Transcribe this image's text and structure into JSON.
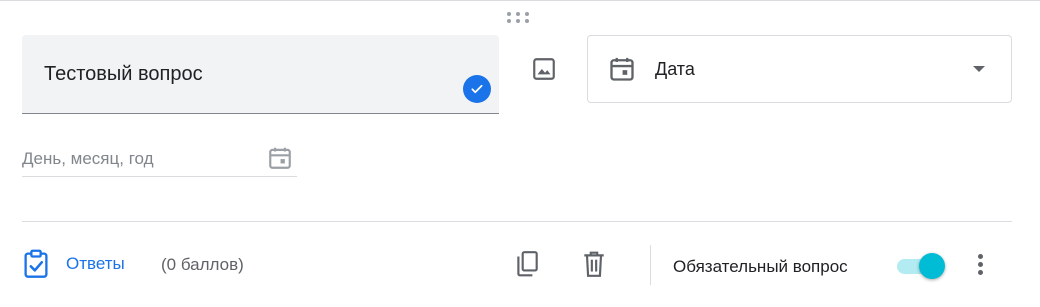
{
  "question": {
    "title": "Тестовый вопрос"
  },
  "type_select": {
    "selected": "Дата"
  },
  "date_field": {
    "placeholder": "День, месяц, год"
  },
  "footer": {
    "answers_label": "Ответы",
    "points": "(0 баллов)",
    "required_label": "Обязательный вопрос",
    "required_on": true
  },
  "colors": {
    "accent": "#1a73e8",
    "toggle_thumb": "#00bcd4",
    "toggle_track": "#b2ebf2"
  },
  "icons": [
    "drag-handle-icon",
    "check-icon",
    "image-icon",
    "calendar-icon",
    "answer-key-icon",
    "copy-icon",
    "trash-icon",
    "more-vert-icon"
  ]
}
